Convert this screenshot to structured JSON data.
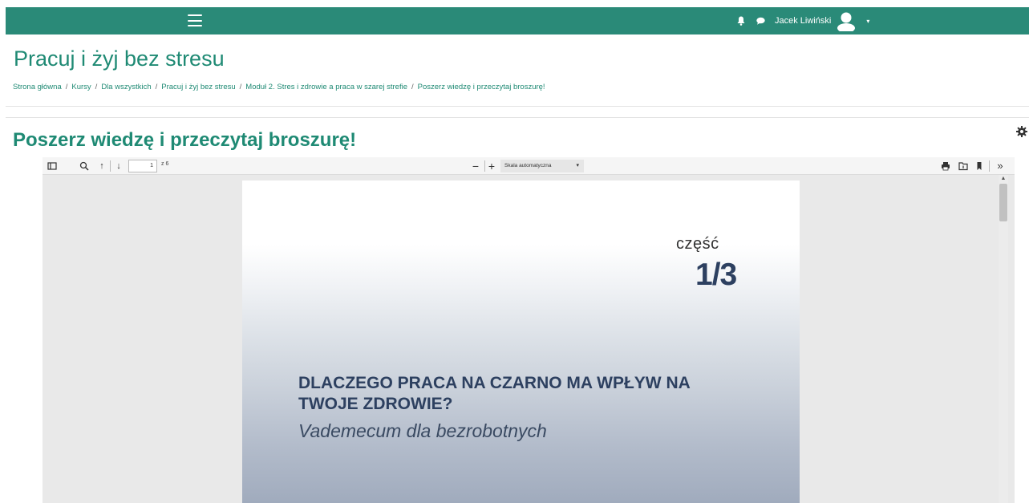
{
  "topbar": {
    "user_name": "Jacek Liwiński",
    "colors": {
      "bar": "#2a8a78"
    },
    "icons": [
      "menu-icon",
      "bell-icon",
      "chat-icon",
      "user-avatar-icon",
      "caret-down-icon"
    ]
  },
  "page": {
    "title": "Pracuj i żyj bez stresu",
    "breadcrumb": [
      "Strona główna",
      "Kursy",
      "Dla wszystkich",
      "Pracuj i żyj bez stresu",
      "Moduł 2. Stres i zdrowie a praca w szarej strefie",
      "Poszerz wiedzę i przeczytaj broszurę!"
    ],
    "breadcrumb_separator": "/",
    "section_title": "Poszerz wiedzę i przeczytaj broszurę!"
  },
  "viewer": {
    "page_number": "1",
    "page_of": "z 6",
    "zoom_label": "Skala automatyczna",
    "zoom_minus": "−",
    "zoom_plus": "+",
    "icons": [
      "sidebar-toggle-icon",
      "search-icon",
      "previous-page-icon",
      "next-page-icon",
      "print-icon",
      "open-file-icon",
      "bookmark-icon",
      "more-tools-icon"
    ]
  },
  "document": {
    "part_label": "część",
    "part_number": "1/3",
    "headline": "DLACZEGO PRACA NA CZARNO MA WPŁYW NA TWOJE ZDROWIE?",
    "subtitle": "Vademecum dla bezrobotnych"
  }
}
